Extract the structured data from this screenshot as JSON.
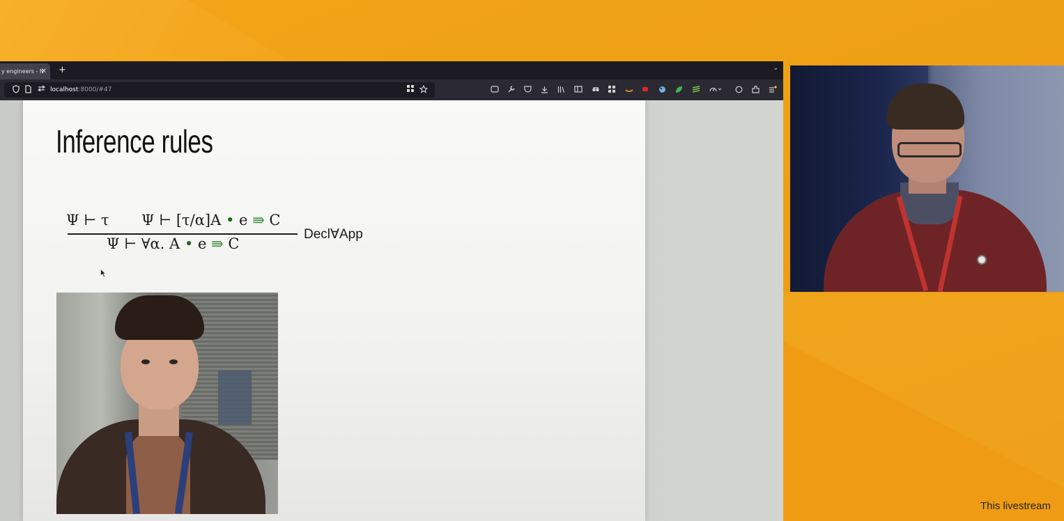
{
  "browser": {
    "tab_title": "y engineers - N",
    "tab_close": "✕",
    "new_tab": "+",
    "tab_list": "⌄",
    "url_host": "localhost",
    "url_rest": ":8000/#47"
  },
  "slide": {
    "title": "Inference rules",
    "rule": {
      "premise1": "Ψ ⊢ τ",
      "premise2_prefix": "Ψ ⊢ [τ/α]A ",
      "dot": "•",
      "premise2_mid": " e ",
      "arrow": "⇛",
      "premise2_suffix": " C",
      "conclusion_prefix": "Ψ ⊢ ∀α. A ",
      "conclusion_mid": " e ",
      "conclusion_suffix": " C",
      "name": "Decl∀App"
    }
  },
  "stream": {
    "footer": "This livestream"
  }
}
